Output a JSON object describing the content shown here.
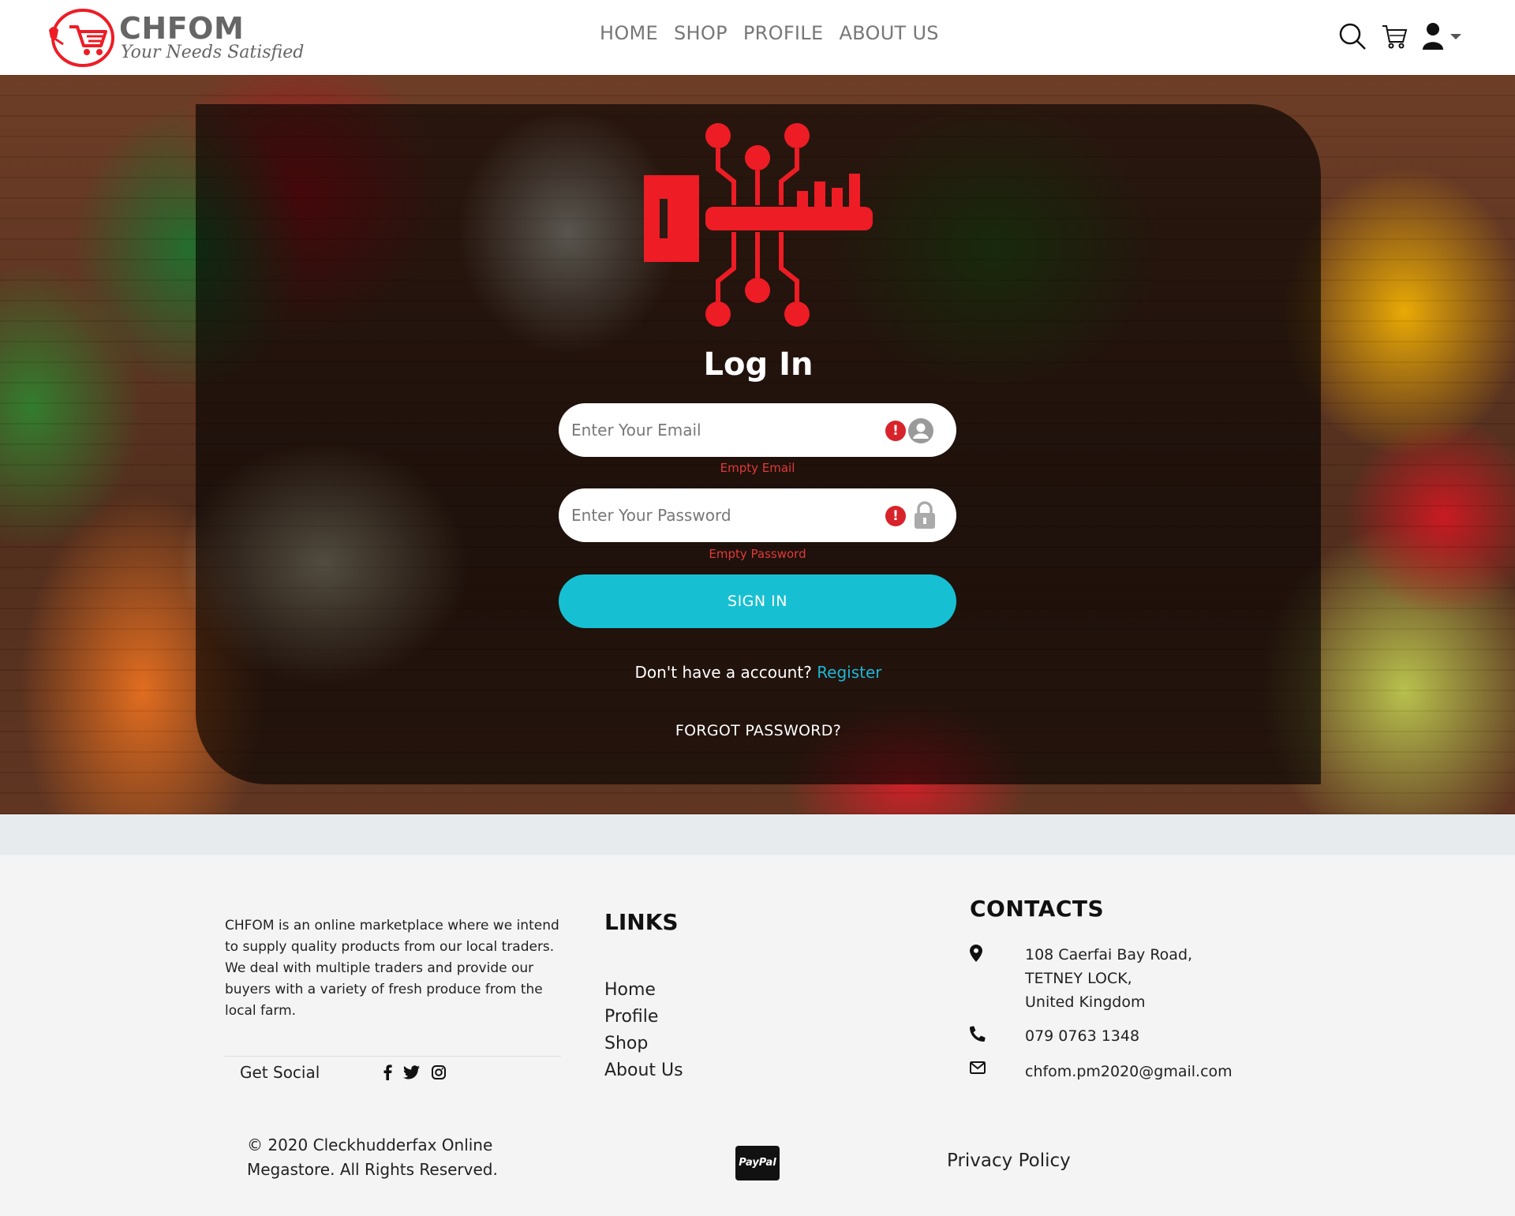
{
  "brand": {
    "name": "CHFOM",
    "tagline": "Your Needs Satisfied",
    "accent_color": "#ee1c25"
  },
  "nav": {
    "items": [
      {
        "label": "HOME"
      },
      {
        "label": "SHOP"
      },
      {
        "label": "PROFILE"
      },
      {
        "label": "ABOUT US"
      }
    ],
    "icons": [
      "search-icon",
      "cart-icon",
      "user-icon",
      "caret-down-icon"
    ]
  },
  "login": {
    "title": "Log In",
    "email": {
      "placeholder": "Enter Your Email",
      "value": "",
      "error": "Empty Email",
      "icon": "user-circle-icon"
    },
    "password": {
      "placeholder": "Enter Your Password",
      "value": "",
      "error": "Empty Password",
      "icon": "lock-icon"
    },
    "error_icon_glyph": "!",
    "signin_label": "SIGN IN",
    "register_prompt": "Don't have a account?",
    "register_label": "Register",
    "forgot_label": "FORGOT PASSWORD?",
    "button_color": "#16c0d2",
    "error_color": "#d8232a"
  },
  "footer": {
    "about": "CHFOM is an online marketplace where we intend to supply quality products from our local traders. We deal with multiple traders and provide our buyers with a variety of fresh produce from the local farm.",
    "social_label": "Get Social",
    "social_icons": [
      "facebook-icon",
      "twitter-icon",
      "instagram-icon"
    ],
    "links_title": "LINKS",
    "links": [
      {
        "label": "Home"
      },
      {
        "label": "Profile"
      },
      {
        "label": "Shop"
      },
      {
        "label": "About Us"
      }
    ],
    "contacts_title": "CONTACTS",
    "address_lines": [
      "108 Caerfai Bay Road,",
      "TETNEY LOCK,",
      "United Kingdom"
    ],
    "phone": "079 0763 1348",
    "email": "chfom.pm2020@gmail.com",
    "copyright": "© 2020 Cleckhudderfax Online Megastore. All Rights Reserved.",
    "payment_label": "PayPal",
    "privacy_label": "Privacy Policy"
  }
}
